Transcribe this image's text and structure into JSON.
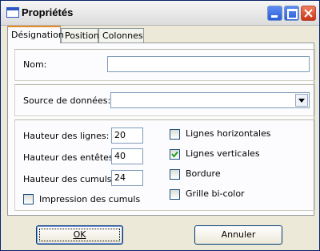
{
  "window": {
    "title": "Propriétés",
    "icon": "window-icon"
  },
  "tabs": [
    {
      "label": "Désignation",
      "active": true
    },
    {
      "label": "Position",
      "active": false
    },
    {
      "label": "Colonnes",
      "active": false
    }
  ],
  "form": {
    "nom": {
      "label": "Nom:",
      "value": ""
    },
    "source": {
      "label": "Source de données:",
      "value": ""
    },
    "hauteur_lignes": {
      "label": "Hauteur des lignes:",
      "value": "20"
    },
    "hauteur_entetes": {
      "label": "Hauteur des entêtes:",
      "value": "40"
    },
    "hauteur_cumuls": {
      "label": "Hauteur des cumuls:",
      "value": "24"
    },
    "impression_cumuls": {
      "label": "Impression des cumuls",
      "checked": false
    },
    "lignes_horizontales": {
      "label": "Lignes horizontales",
      "checked": false
    },
    "lignes_verticales": {
      "label": "Lignes verticales",
      "checked": true
    },
    "bordure": {
      "label": "Bordure",
      "checked": false
    },
    "grille_bicolor": {
      "label": "Grille bi-color",
      "checked": false
    }
  },
  "buttons": {
    "ok": "OK",
    "annuler": "Annuler"
  }
}
